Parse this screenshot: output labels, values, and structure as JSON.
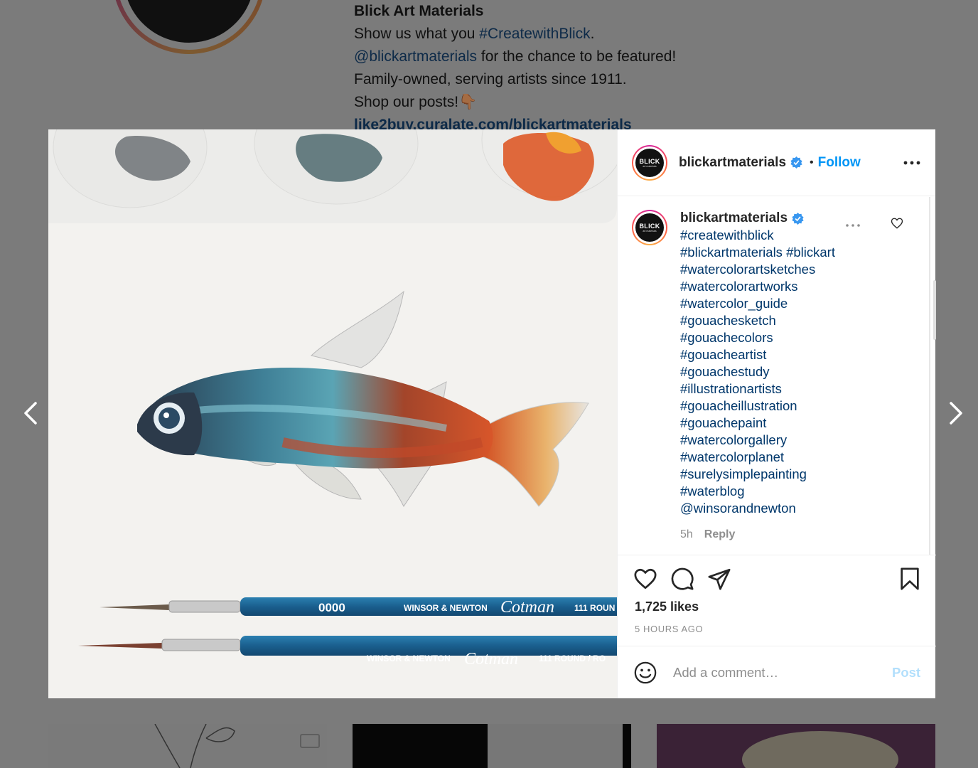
{
  "profile_bio": {
    "name": "Blick Art Materials",
    "line1_prefix": "Show us what you ",
    "line1_link": "#CreatewithBlick",
    "line1_suffix": ".",
    "line2_link": "@blickartmaterials",
    "line2_suffix": " for the chance to be featured!",
    "line3": "Family-owned, serving artists since 1911.",
    "line4": "Shop our posts!👇🏾",
    "url": "like2buy.curalate.com/blickartmaterials"
  },
  "post": {
    "image_icon": "watercolor-fish-painting",
    "avatar_logo": {
      "brand": "BLICK",
      "sub": "art materials"
    },
    "header": {
      "username": "blickartmaterials",
      "separator": "•",
      "follow_label": "Follow"
    },
    "caption": {
      "username": "blickartmaterials",
      "tags": [
        "#createwithblick",
        "#blickartmaterials #blickart",
        "#watercolorartsketches",
        "#watercolorartworks",
        "#watercolor_guide",
        "#gouachesketch",
        "#gouachecolors",
        "#gouacheartist",
        "#gouachestudy",
        "#illustrationartists",
        "#gouacheillustration",
        "#gouachepaint",
        "#watercolorgallery",
        "#watercolorplanet",
        "#surelysimplepainting",
        "#waterblog",
        "@winsorandnewton"
      ],
      "age": "5h",
      "reply_label": "Reply"
    },
    "likes": "1,725 likes",
    "time_ago": "5 HOURS AGO",
    "comment": {
      "placeholder": "Add a comment…",
      "post_label": "Post"
    },
    "brush_text": {
      "size": "0000",
      "maker": "WINSOR & NEWTON",
      "model": "Cotman",
      "series": "111 ROUN",
      "series2": "111 ROUND / RO"
    }
  },
  "colors": {
    "follow": "#0095f6",
    "link": "#00376b",
    "post_disabled": "#b2dffc",
    "overlay": "#7b7b7b"
  }
}
